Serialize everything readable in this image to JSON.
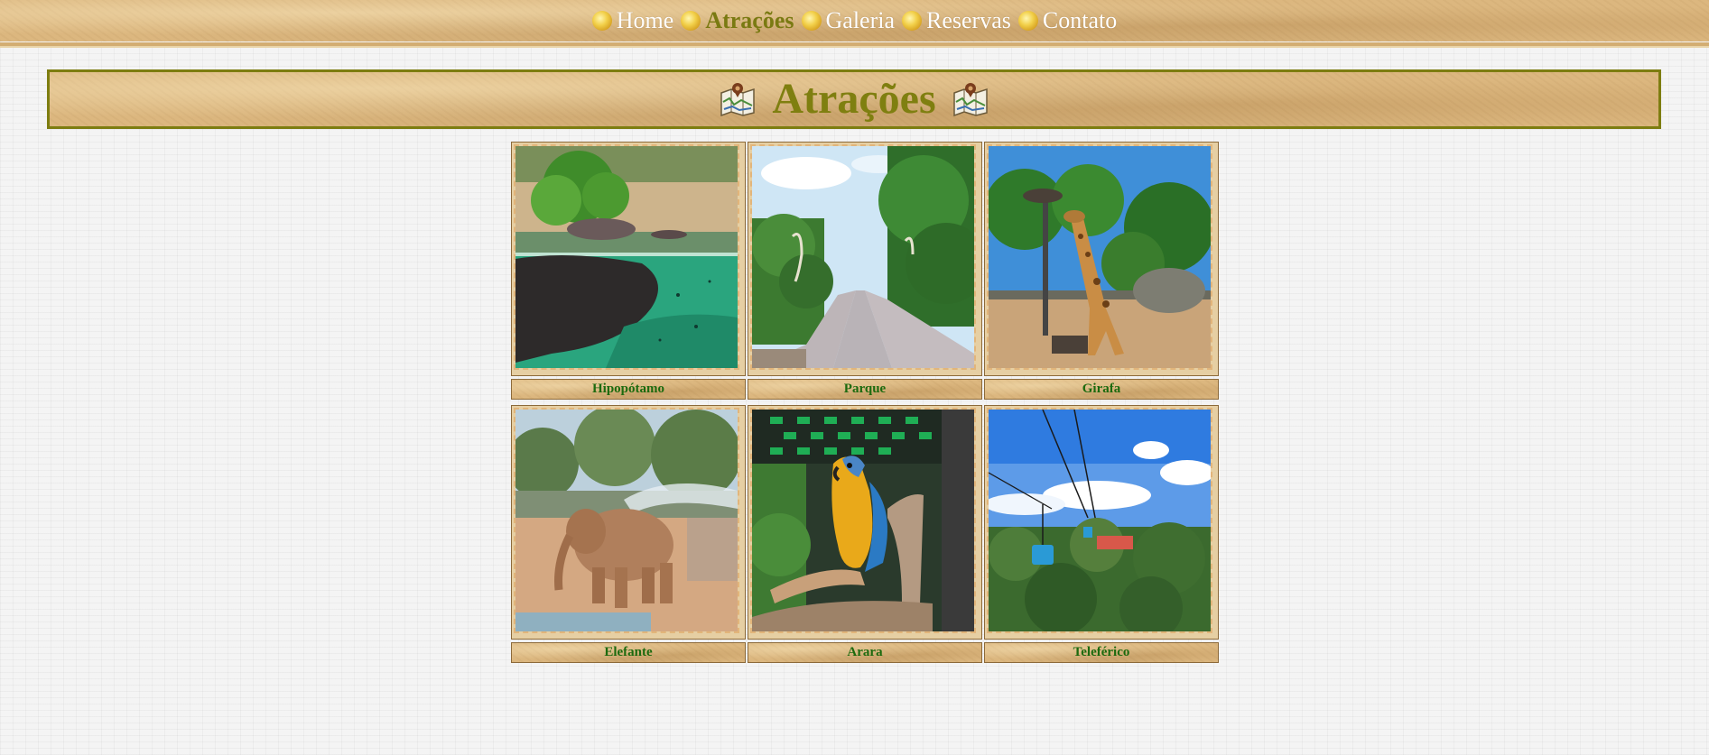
{
  "nav": {
    "items": [
      {
        "label": "Home",
        "active": false
      },
      {
        "label": "Atrações",
        "active": true
      },
      {
        "label": "Galeria",
        "active": false
      },
      {
        "label": "Reservas",
        "active": false
      },
      {
        "label": "Contato",
        "active": false
      }
    ]
  },
  "page": {
    "title": "Atrações"
  },
  "gallery": {
    "items": [
      {
        "caption": "Hipopótamo",
        "image": "hippo-underwater-photo"
      },
      {
        "caption": "Parque",
        "image": "park-path-topiary-photo"
      },
      {
        "caption": "Girafa",
        "image": "giraffe-photo"
      },
      {
        "caption": "Elefante",
        "image": "elephant-photo"
      },
      {
        "caption": "Arara",
        "image": "macaw-photo"
      },
      {
        "caption": "Teleférico",
        "image": "cable-car-photo"
      }
    ]
  },
  "colors": {
    "parchment": "#dcb77f",
    "title": "#7f7f10",
    "caption_text": "#1c6a0e",
    "banner_border": "#7d7d10"
  }
}
